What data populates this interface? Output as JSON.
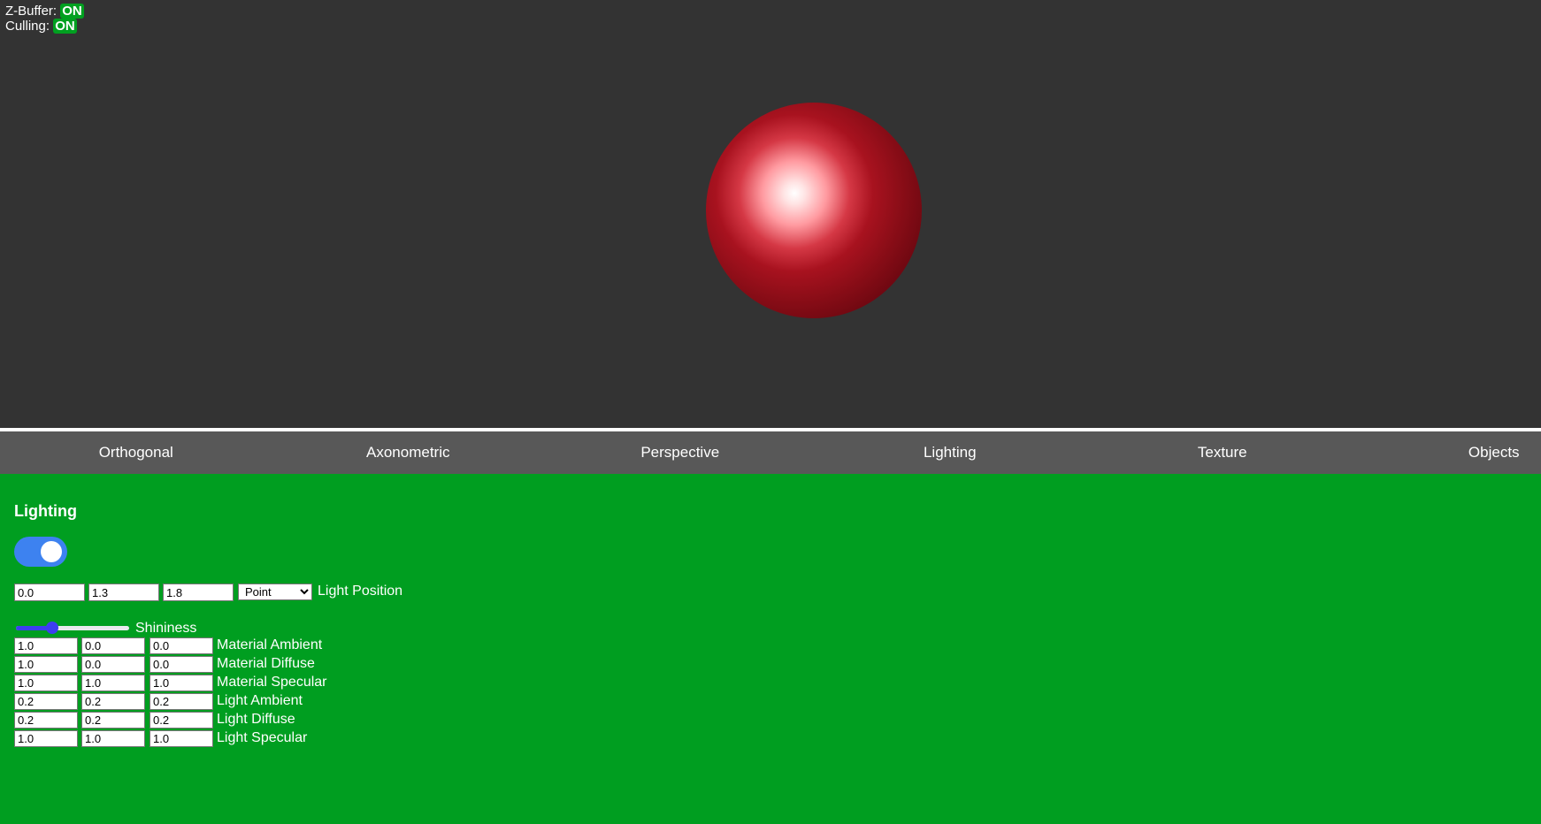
{
  "hud": {
    "zbuffer_label": "Z-Buffer:",
    "zbuffer_value": "ON",
    "culling_label": "Culling:",
    "culling_value": "ON"
  },
  "tabs": [
    {
      "label": "Orthogonal",
      "active": false
    },
    {
      "label": "Axonometric",
      "active": false
    },
    {
      "label": "Perspective",
      "active": false
    },
    {
      "label": "Lighting",
      "active": true
    },
    {
      "label": "Texture",
      "active": false
    },
    {
      "label": "Objects",
      "active": false
    }
  ],
  "panel": {
    "title": "Lighting",
    "lighting_enabled": true,
    "light_position": {
      "x": "0.0",
      "y": "1.3",
      "z": "1.8",
      "type": "Point",
      "type_options": [
        "Point"
      ],
      "label": "Light Position"
    },
    "shininess": {
      "label": "Shininess",
      "fraction": 0.3
    },
    "rows": [
      {
        "label": "Material Ambient",
        "values": [
          "1.0",
          "0.0",
          "0.0"
        ]
      },
      {
        "label": "Material Diffuse",
        "values": [
          "1.0",
          "0.0",
          "0.0"
        ]
      },
      {
        "label": "Material Specular",
        "values": [
          "1.0",
          "1.0",
          "1.0"
        ]
      },
      {
        "label": "Light Ambient",
        "values": [
          "0.2",
          "0.2",
          "0.2"
        ]
      },
      {
        "label": "Light Diffuse",
        "values": [
          "0.2",
          "0.2",
          "0.2"
        ]
      },
      {
        "label": "Light Specular",
        "values": [
          "1.0",
          "1.0",
          "1.0"
        ]
      }
    ]
  },
  "colors": {
    "viewport_bg": "#333333",
    "tab_bg": "#585858",
    "tab_active": "#00e02c",
    "panel_bg": "#009e20",
    "toggle_on": "#3d82f0",
    "slider_accent": "#3e3ef0",
    "sphere": "#a8121f"
  }
}
